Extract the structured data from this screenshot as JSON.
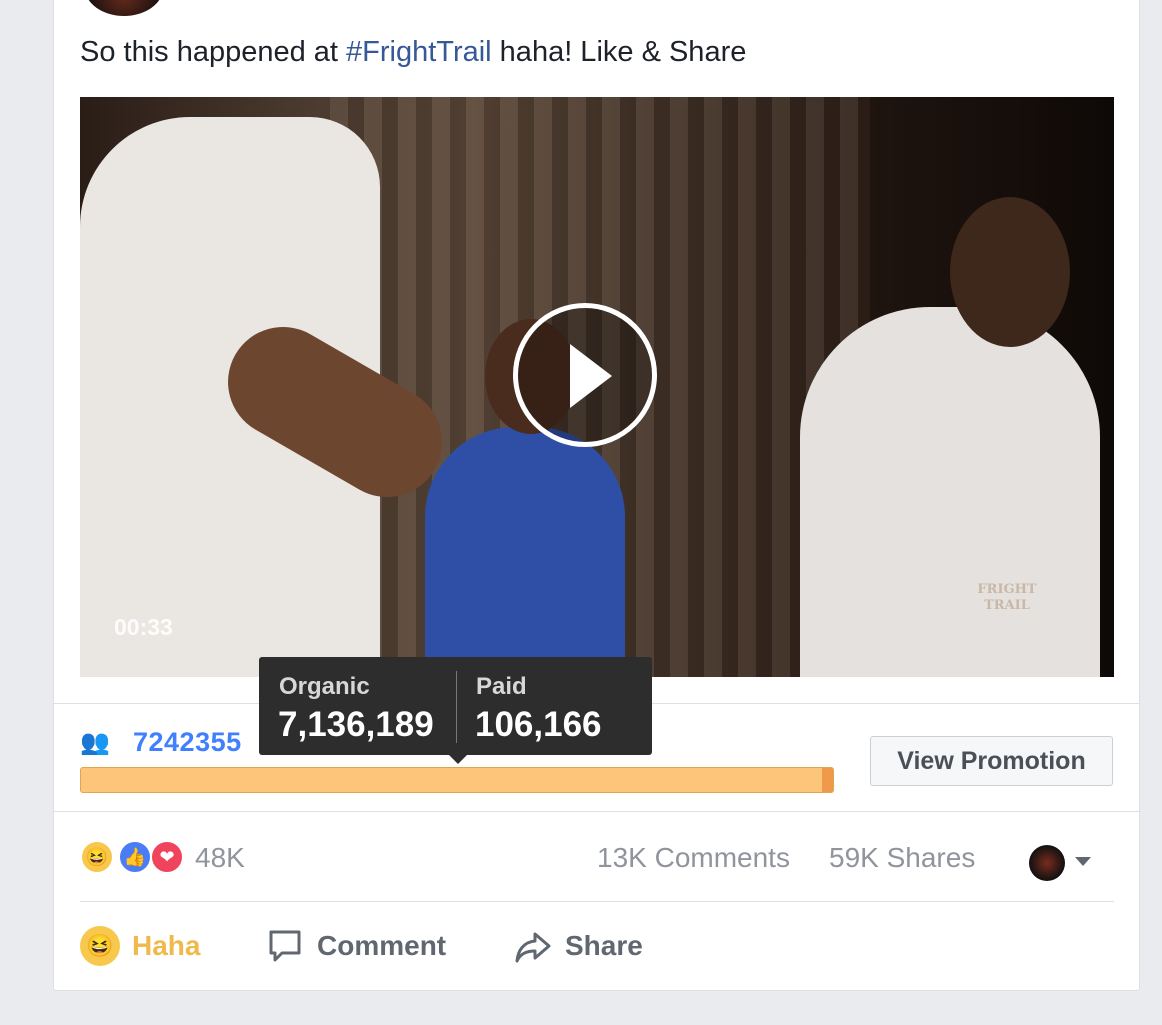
{
  "post": {
    "caption_prefix": "So this happened at ",
    "caption_tag": "#FrightTrail",
    "caption_suffix": " haha! Like & Share"
  },
  "video": {
    "duration": "00:33",
    "watermark": "FRIGHT TRAIL"
  },
  "reach": {
    "total": "7242355",
    "bar_organic_fraction": 0.985
  },
  "tooltip": {
    "organic_label": "Organic",
    "organic_value": "7,136,189",
    "paid_label": "Paid",
    "paid_value": "106,166"
  },
  "promotion": {
    "button_label": "View Promotion"
  },
  "engagement": {
    "reaction_count": "48K",
    "comments": "13K Comments",
    "shares": "59K Shares",
    "reaction_icons": [
      "haha-icon",
      "like-icon",
      "love-icon"
    ]
  },
  "actions": {
    "haha_label": "Haha",
    "comment_label": "Comment",
    "share_label": "Share"
  },
  "colors": {
    "link": "#365899",
    "reach_number": "#4080ff",
    "bar_fill": "#fcc57a",
    "haha": "#f0b94b"
  }
}
